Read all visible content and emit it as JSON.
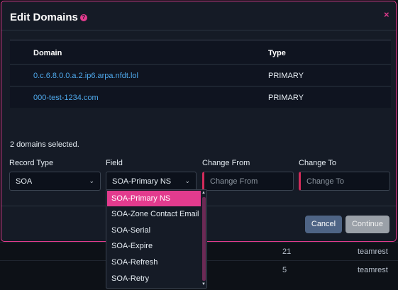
{
  "background_rows": [
    {
      "count": "21",
      "owner": "teamrest"
    },
    {
      "count": "5",
      "owner": "teamrest"
    }
  ],
  "modal": {
    "title": "Edit Domains",
    "help_icon": "?",
    "close_icon": "×"
  },
  "table": {
    "headers": {
      "domain": "Domain",
      "type": "Type"
    },
    "rows": [
      {
        "domain": "0.c.6.8.0.0.a.2.ip6.arpa.nfdt.lol",
        "type": "PRIMARY"
      },
      {
        "domain": "000-test-1234.com",
        "type": "PRIMARY"
      }
    ]
  },
  "selected_text": "2 domains selected.",
  "form": {
    "record_type": {
      "label": "Record Type",
      "value": "SOA"
    },
    "field": {
      "label": "Field",
      "value": "SOA-Primary NS"
    },
    "change_from": {
      "label": "Change From",
      "placeholder": "Change From"
    },
    "change_to": {
      "label": "Change To",
      "placeholder": "Change To"
    }
  },
  "dropdown": {
    "options": [
      "SOA-Primary NS",
      "SOA-Zone Contact Email",
      "SOA-Serial",
      "SOA-Expire",
      "SOA-Refresh",
      "SOA-Retry"
    ],
    "selected_index": 0
  },
  "buttons": {
    "cancel": "Cancel",
    "continue": "Continue"
  },
  "colors": {
    "accent": "#e33b8e",
    "link": "#4fa9ec",
    "error_border": "#d22b5a"
  }
}
